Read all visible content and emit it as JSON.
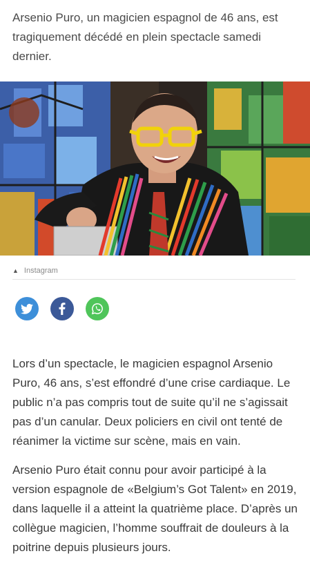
{
  "article": {
    "lead": "Arsenio Puro, un magicien espagnol de 46 ans, est tragiquement décédé en plein spectacle samedi dernier.",
    "image_credit": "Instagram",
    "paragraphs": [
      "Lors d’un spectacle, le magicien espagnol Arsenio Puro, 46 ans, s’est effondré d’une crise cardiaque. Le public n’a pas compris tout de suite qu’il ne s’agissait pas d’un canular. Deux policiers en civil ont tenté de réanimer la victime sur scène, mais en vain.",
      "Arsenio Puro était connu pour avoir participé à la version espagnole de «Belgium’s Got Talent» en 2019, dans laquelle il a atteint la quatrième place. D’après un collègue magicien, l’homme souffrait de douleurs à la poitrine depuis plusieurs jours."
    ]
  },
  "share": {
    "buttons": [
      {
        "icon": "twitter-icon",
        "color": "#3d8fd9"
      },
      {
        "icon": "facebook-icon",
        "color": "#3b5998"
      },
      {
        "icon": "whatsapp-icon",
        "color": "#4fc55a"
      }
    ]
  }
}
